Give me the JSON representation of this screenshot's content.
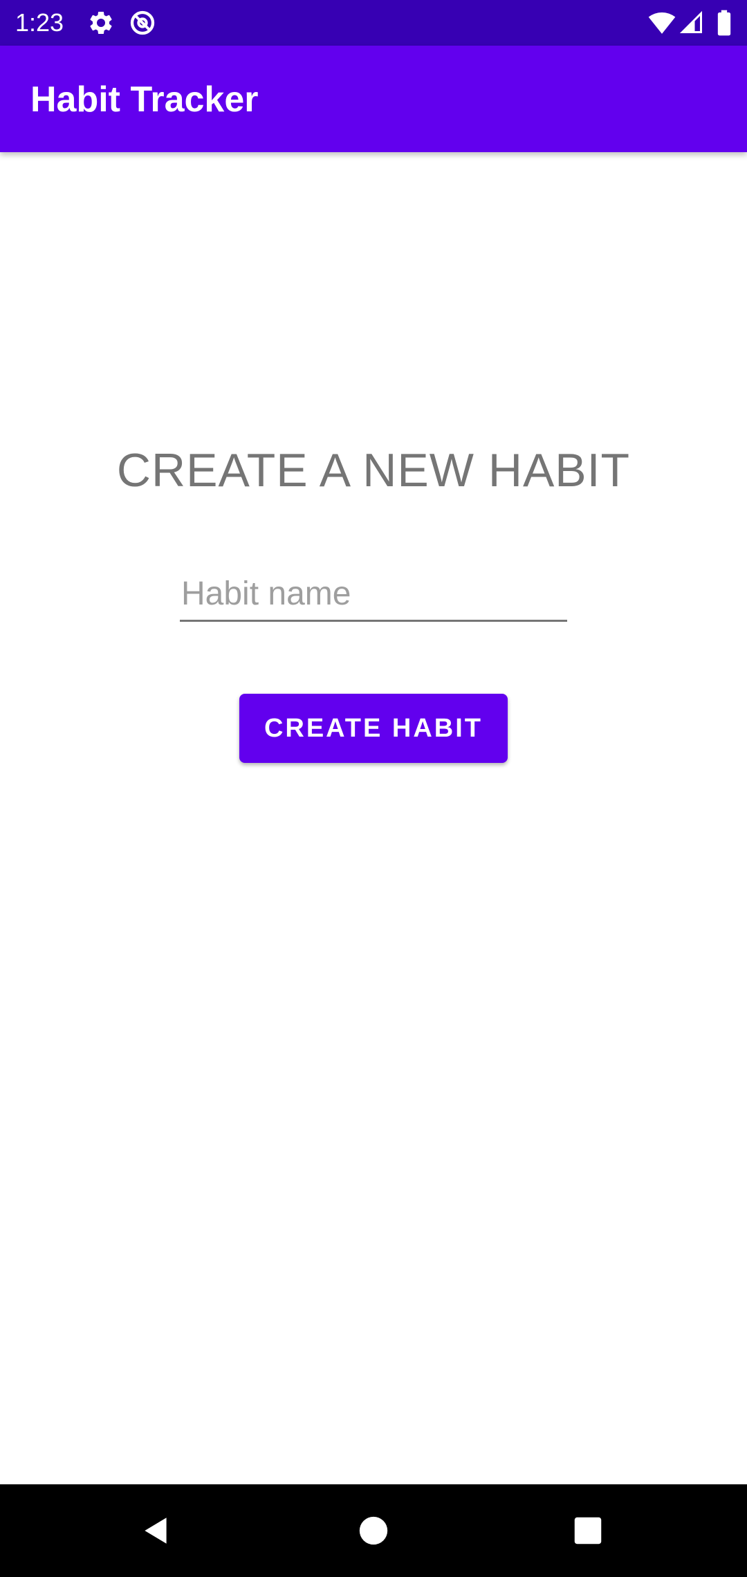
{
  "status_bar": {
    "time": "1:23",
    "left_icons": [
      "gear-icon",
      "at-sign-icon"
    ],
    "right_icons": [
      "wifi-icon",
      "signal-icon",
      "battery-icon"
    ],
    "background": "#3700b3"
  },
  "app_bar": {
    "title": "Habit Tracker",
    "background": "#6200ee"
  },
  "main": {
    "heading": "CREATE A NEW HABIT",
    "habit_input": {
      "value": "",
      "placeholder": "Habit name"
    },
    "create_button_label": "CREATE HABIT",
    "accent": "#6200ee"
  },
  "nav_bar": {
    "buttons": [
      "back-icon",
      "home-icon",
      "recents-icon"
    ]
  }
}
